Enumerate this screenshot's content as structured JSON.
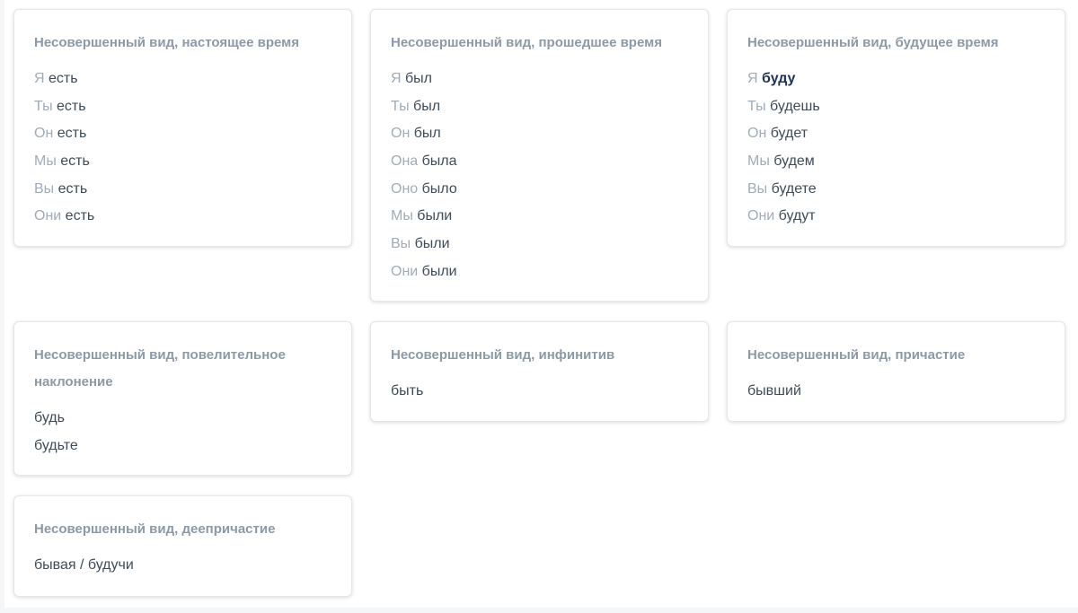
{
  "cards": {
    "present": {
      "title": "Несовершенный вид, настоящее время",
      "rows": [
        {
          "pronoun": "Я",
          "form": "есть"
        },
        {
          "pronoun": "Ты",
          "form": "есть"
        },
        {
          "pronoun": "Он",
          "form": "есть"
        },
        {
          "pronoun": "Мы",
          "form": "есть"
        },
        {
          "pronoun": "Вы",
          "form": "есть"
        },
        {
          "pronoun": "Они",
          "form": "есть"
        }
      ]
    },
    "past": {
      "title": "Несовершенный вид, прошедшее время",
      "rows": [
        {
          "pronoun": "Я",
          "form": "был"
        },
        {
          "pronoun": "Ты",
          "form": "был"
        },
        {
          "pronoun": "Он",
          "form": "был"
        },
        {
          "pronoun": "Она",
          "form": "была"
        },
        {
          "pronoun": "Оно",
          "form": "было"
        },
        {
          "pronoun": "Мы",
          "form": "были"
        },
        {
          "pronoun": "Вы",
          "form": "были"
        },
        {
          "pronoun": "Они",
          "form": "были"
        }
      ]
    },
    "future": {
      "title": "Несовершенный вид, будущее время",
      "rows": [
        {
          "pronoun": "Я",
          "form": "буду"
        },
        {
          "pronoun": "Ты",
          "form": "будешь"
        },
        {
          "pronoun": "Он",
          "form": "будет"
        },
        {
          "pronoun": "Мы",
          "form": "будем"
        },
        {
          "pronoun": "Вы",
          "form": "будете"
        },
        {
          "pronoun": "Они",
          "form": "будут"
        }
      ]
    },
    "imperative": {
      "title_line1": "Несовершенный вид, повелительное",
      "title_line2": "наклонение",
      "forms": [
        "будь",
        "будьте"
      ]
    },
    "infinitive": {
      "title": "Несовершенный вид, инфинитив",
      "value": "быть"
    },
    "participle": {
      "title": "Несовершенный вид, причастие",
      "value": "бывший"
    },
    "gerund": {
      "title": "Несовершенный вид, деепричастие",
      "value": "бывая / будучи"
    }
  }
}
